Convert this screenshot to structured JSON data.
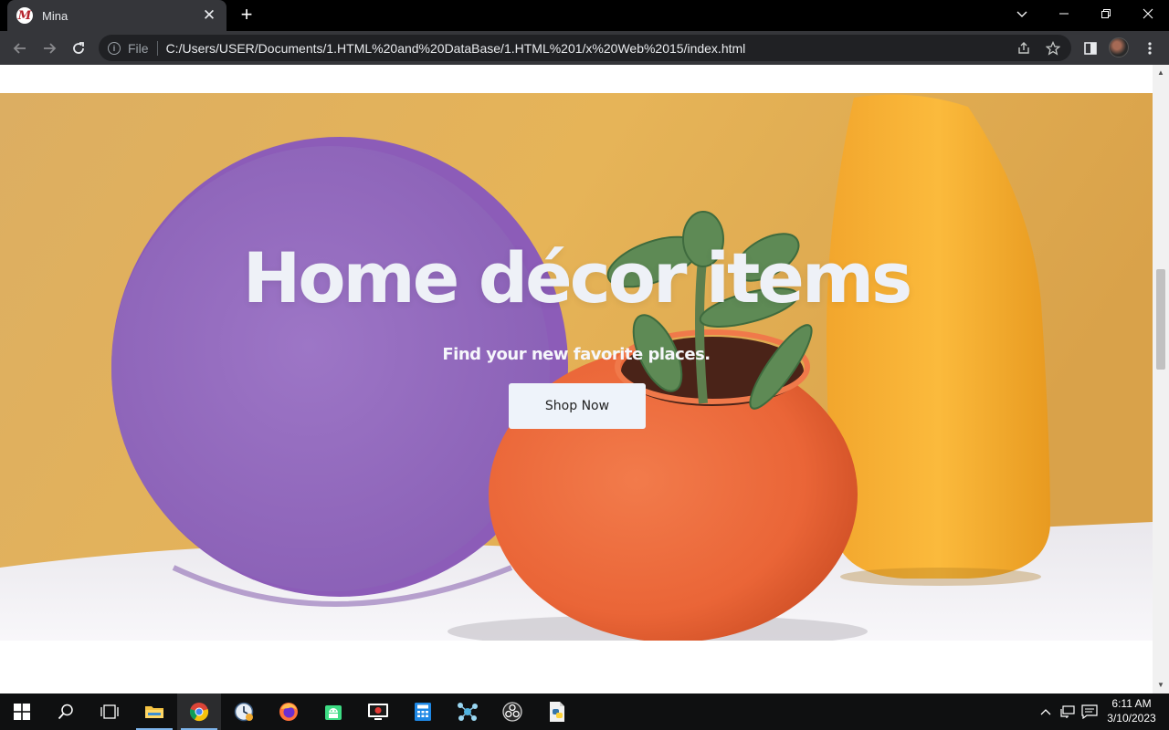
{
  "browser": {
    "tab_title": "Mina",
    "tab_favicon_letter": "M",
    "scheme_label": "File",
    "url": "C:/Users/USER/Documents/1.HTML%20and%20DataBase/1.HTML%201/x%20Web%2015/index.html",
    "icons": {
      "back": "arrow-left-icon",
      "forward": "arrow-right-icon",
      "reload": "reload-icon",
      "info": "info-icon",
      "share": "share-icon",
      "bookmark": "star-icon",
      "side_panel": "side-panel-icon",
      "menu": "kebab-menu-icon"
    }
  },
  "hero": {
    "title": "Home décor items",
    "subtitle": "Find your new favorite places.",
    "button_label": "Shop Now",
    "colors": {
      "backdrop": "#e4b25d",
      "disc": "#9a6fc4",
      "pot": "#ef6d3f",
      "vase": "#f4ad31",
      "button_bg": "#eef3fa"
    }
  },
  "taskbar": {
    "apps": [
      {
        "name": "start",
        "icon": "windows-logo-icon"
      },
      {
        "name": "search",
        "icon": "search-icon"
      },
      {
        "name": "task-view",
        "icon": "task-view-icon"
      },
      {
        "name": "file-explorer",
        "icon": "folder-icon"
      },
      {
        "name": "chrome",
        "icon": "chrome-icon"
      },
      {
        "name": "clock-app",
        "icon": "clock-icon"
      },
      {
        "name": "firefox",
        "icon": "firefox-icon"
      },
      {
        "name": "android-studio",
        "icon": "android-icon"
      },
      {
        "name": "screen-recorder",
        "icon": "record-icon"
      },
      {
        "name": "calculator",
        "icon": "calculator-icon"
      },
      {
        "name": "network-app",
        "icon": "network-nodes-icon"
      },
      {
        "name": "obs",
        "icon": "obs-icon"
      },
      {
        "name": "python-file",
        "icon": "python-icon"
      }
    ],
    "time": "6:11 AM",
    "date": "3/10/2023"
  }
}
